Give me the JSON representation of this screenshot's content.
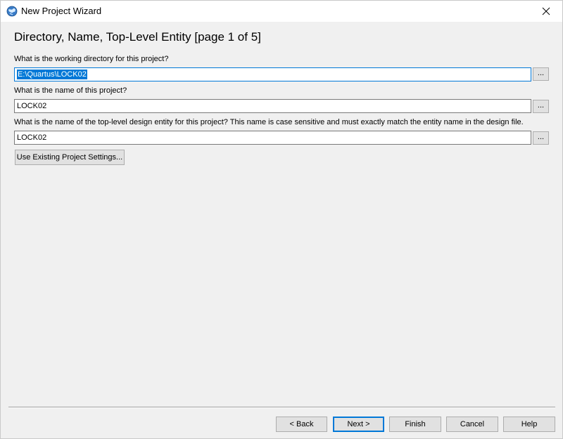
{
  "window": {
    "title": "New Project Wizard",
    "app_icon": "globe-icon",
    "close_icon": "close-icon"
  },
  "page": {
    "heading": "Directory, Name, Top-Level Entity [page 1 of 5]"
  },
  "fields": [
    {
      "label": "What is the working directory for this project?",
      "value": "E:\\Quartus\\LOCK02",
      "selected": true,
      "browse_label": "..."
    },
    {
      "label": "What is the name of this project?",
      "value": "LOCK02",
      "selected": false,
      "browse_label": "..."
    },
    {
      "label": "What is the name of the top-level design entity for this project? This name is case sensitive and must exactly match the entity name in the design file.",
      "value": "LOCK02",
      "selected": false,
      "browse_label": "..."
    }
  ],
  "existing_settings_label": "Use Existing Project Settings...",
  "footer": {
    "back": "< Back",
    "next": "Next >",
    "finish": "Finish",
    "cancel": "Cancel",
    "help": "Help"
  },
  "colors": {
    "accent": "#0078d7",
    "background": "#f0f0f0",
    "button_face": "#e1e1e1"
  }
}
